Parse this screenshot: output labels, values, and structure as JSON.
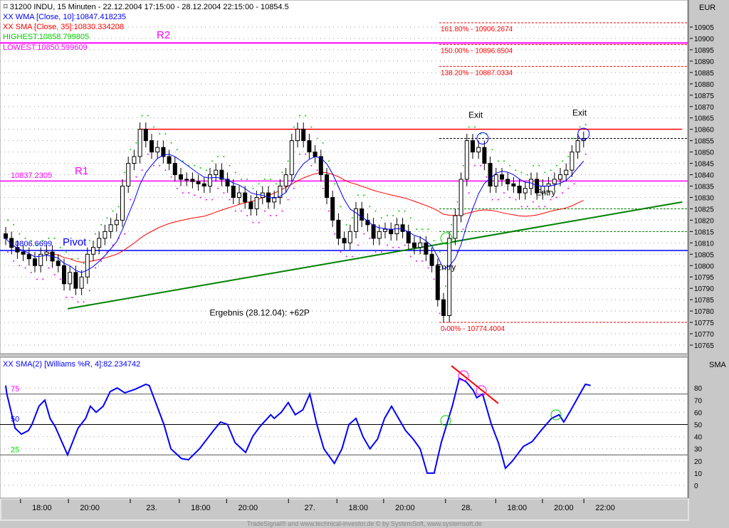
{
  "header": {
    "title": "31200  INDU, 15 Minuten - 22.12.2004 17:15:00 - 28.12.2004 22:15:00 - 10854.5",
    "wma": "XX WMA [Close, 10]:10847.418235",
    "sma": "XX SMA [Close, 35]:10830.334208",
    "highest": "HIGHEST:10858.799805",
    "lowest": "LOWEST:10850.599609",
    "currency": "EUR"
  },
  "lower": {
    "title": "XX SMA(2) [Williams %R, 4]:82.234742",
    "axis_label": "SMA",
    "l75": "75",
    "l50": "50",
    "l25": "25"
  },
  "footer": "TradeSignal® and www.technical-investor.de © by SystemSoft, www.systemsoft.de",
  "colors": {
    "wma": "#0000ff",
    "sma": "#ff0000",
    "r": "#ff00ff",
    "pivot": "#0000ff",
    "trend": "#008000"
  },
  "chart_data": [
    {
      "type": "candlestick",
      "title": "INDU 15 Minuten",
      "ylim": [
        10762,
        10912
      ],
      "yticks": [
        10905,
        10900,
        10895,
        10890,
        10885,
        10880,
        10875,
        10870,
        10865,
        10860,
        10855,
        10850,
        10845,
        10840,
        10835,
        10830,
        10825,
        10820,
        10815,
        10810,
        10805,
        10800,
        10795,
        10790,
        10785,
        10780,
        10775,
        10770,
        10765
      ],
      "xticks": [
        {
          "bar": 6.2,
          "label": "18:00"
        },
        {
          "bar": 14.4,
          "label": "20:00"
        },
        {
          "bar": 25,
          "label": "23."
        },
        {
          "bar": 33.4,
          "label": "18:00"
        },
        {
          "bar": 41.5,
          "label": "20:00"
        },
        {
          "bar": 52.1,
          "label": "27."
        },
        {
          "bar": 60.4,
          "label": "18:00"
        },
        {
          "bar": 68.4,
          "label": "20:00"
        },
        {
          "bar": 79,
          "label": "28."
        },
        {
          "bar": 87.6,
          "label": "18:00"
        },
        {
          "bar": 95.6,
          "label": "20:00"
        },
        {
          "bar": 102.7,
          "label": "22:00"
        }
      ],
      "closes": [
        10812,
        10808,
        10806,
        10805,
        10803,
        10800,
        10805,
        10806,
        10802,
        10800,
        10792,
        10797,
        10790,
        10795,
        10805,
        10808,
        10812,
        10815,
        10818,
        10820,
        10835,
        10845,
        10848,
        10860,
        10855,
        10850,
        10852,
        10848,
        10845,
        10840,
        10838,
        10838,
        10837,
        10836,
        10835,
        10840,
        10842,
        10838,
        10835,
        10830,
        10832,
        10828,
        10825,
        10830,
        10832,
        10828,
        10830,
        10835,
        10840,
        10855,
        10860,
        10855,
        10850,
        10848,
        10840,
        10830,
        10820,
        10812,
        10810,
        10815,
        10825,
        10820,
        10818,
        10812,
        10815,
        10816,
        10814,
        10818,
        10815,
        10810,
        10808,
        10810,
        10805,
        10800,
        10785,
        10778,
        10812,
        10822,
        10838,
        10855,
        10850,
        10852,
        10845,
        10835,
        10840,
        10838,
        10836,
        10835,
        10832,
        10834,
        10838,
        10832,
        10835,
        10836,
        10838,
        10840,
        10842,
        10850,
        10855,
        10856
      ],
      "levels": [
        {
          "name": "R2",
          "label": "R2",
          "value": 10898,
          "color": "#ff00ff"
        },
        {
          "name": "R1",
          "label": "R1",
          "value": 10837.2305,
          "text": "10837.2305",
          "color": "#ff00ff"
        },
        {
          "name": "Pivot",
          "label": "Pivot",
          "value": 10806.6699,
          "text": "10806.6699",
          "color": "#0000ff"
        },
        {
          "name": "resistance",
          "value": 10860,
          "color": "#ff0000",
          "from": 23
        }
      ],
      "fib": [
        {
          "text": "161.80% - 10906.2674",
          "value": 10906.2674
        },
        {
          "text": "150.00% - 10896.6504",
          "value": 10896.6504
        },
        {
          "text": "138.20% - 10887.0334",
          "value": 10887.0334
        },
        {
          "text": "0.00% - 10774.4004",
          "value": 10774.4004
        }
      ],
      "green_levels": [
        10825,
        10815,
        10856
      ],
      "trendline": [
        [
          10.6,
          10781
        ],
        [
          115.9,
          10828
        ]
      ],
      "annotations": [
        {
          "text": "Exit",
          "bar": 80.5,
          "value": 10865
        },
        {
          "text": "Exit",
          "bar": 98.3,
          "value": 10866
        },
        {
          "text": "Entry",
          "bar": 75.4,
          "value": 10798
        },
        {
          "text": "Entry",
          "bar": 92.5,
          "value": 10831
        },
        {
          "text": "Ergebnis (28.12.04): +62P",
          "bar": 43.5,
          "value": 10778
        }
      ]
    },
    {
      "type": "line",
      "title": "SMA(2) [Williams %R, 4]",
      "ylim": [
        -8,
        92
      ],
      "yticks": [
        80,
        70,
        60,
        50,
        40,
        30,
        20,
        10,
        0
      ],
      "hlines": [
        75,
        50,
        25
      ],
      "points": [
        [
          0,
          82
        ],
        [
          0.2,
          75
        ],
        [
          1.6,
          47
        ],
        [
          2.7,
          42
        ],
        [
          3.9,
          45
        ],
        [
          4.5,
          50
        ],
        [
          5.7,
          65
        ],
        [
          6.7,
          70
        ],
        [
          7.6,
          55
        ],
        [
          8.5,
          48
        ],
        [
          10.6,
          25
        ],
        [
          12.4,
          47
        ],
        [
          13.7,
          55
        ],
        [
          14.5,
          65
        ],
        [
          15.5,
          60
        ],
        [
          16.7,
          65
        ],
        [
          17.9,
          77
        ],
        [
          19.1,
          80
        ],
        [
          20.4,
          76
        ],
        [
          22.2,
          79
        ],
        [
          24,
          83
        ],
        [
          24.6,
          82
        ],
        [
          27.1,
          50
        ],
        [
          28.3,
          30
        ],
        [
          30.1,
          22
        ],
        [
          31.3,
          21
        ],
        [
          33.2,
          30
        ],
        [
          35.6,
          45
        ],
        [
          36.8,
          52
        ],
        [
          38,
          50
        ],
        [
          39.3,
          35
        ],
        [
          41.1,
          27
        ],
        [
          42.3,
          40
        ],
        [
          43.5,
          48
        ],
        [
          45.4,
          58
        ],
        [
          46,
          55
        ],
        [
          47.2,
          60
        ],
        [
          48.4,
          68
        ],
        [
          49.6,
          58
        ],
        [
          50.9,
          62
        ],
        [
          52.1,
          75
        ],
        [
          53.3,
          50
        ],
        [
          54.5,
          30
        ],
        [
          56.3,
          18
        ],
        [
          57.6,
          30
        ],
        [
          58.8,
          50
        ],
        [
          60,
          55
        ],
        [
          61.2,
          40
        ],
        [
          62.4,
          30
        ],
        [
          63.7,
          38
        ],
        [
          64.9,
          55
        ],
        [
          66.1,
          65
        ],
        [
          67.3,
          55
        ],
        [
          68.5,
          45
        ],
        [
          69.8,
          38
        ],
        [
          71,
          30
        ],
        [
          72.2,
          10
        ],
        [
          73.4,
          10
        ],
        [
          74.6,
          35
        ],
        [
          76.5,
          65
        ],
        [
          77.7,
          88
        ],
        [
          78.9,
          85
        ],
        [
          80.1,
          78
        ],
        [
          80.7,
          72
        ],
        [
          81.7,
          75
        ],
        [
          83.2,
          50
        ],
        [
          84.4,
          35
        ],
        [
          85.6,
          14
        ],
        [
          86.8,
          20
        ],
        [
          88.7,
          32
        ],
        [
          90.2,
          36
        ],
        [
          91.7,
          45
        ],
        [
          93.5,
          55
        ],
        [
          94.8,
          58
        ],
        [
          95.6,
          52
        ],
        [
          96.6,
          60
        ],
        [
          98,
          72
        ],
        [
          99.3,
          83
        ],
        [
          100.2,
          82
        ]
      ]
    }
  ]
}
